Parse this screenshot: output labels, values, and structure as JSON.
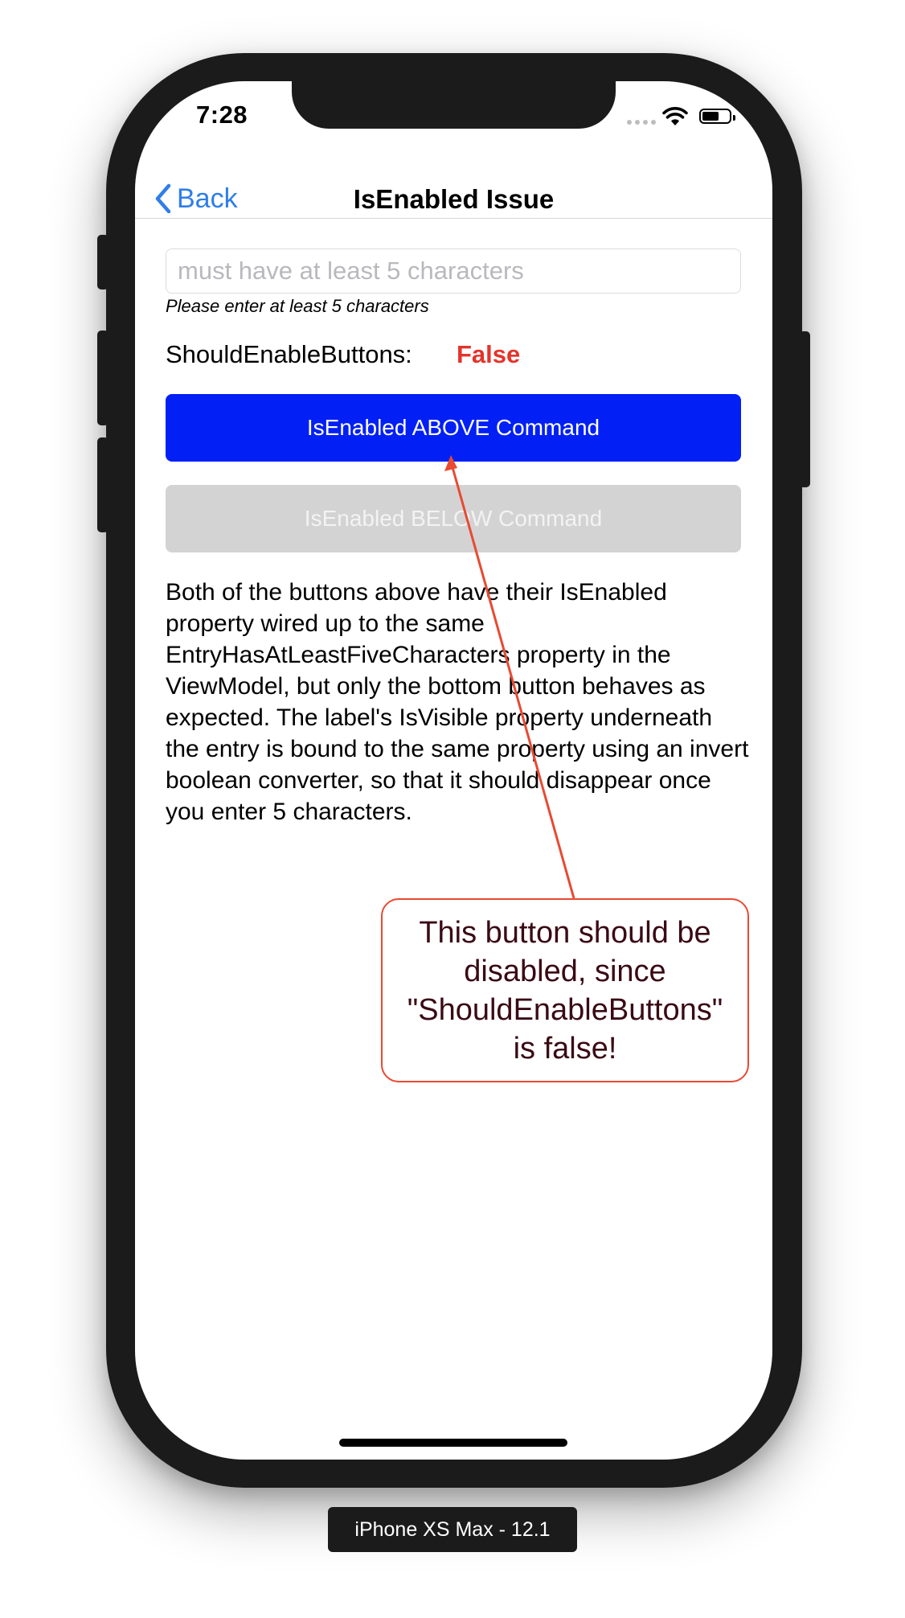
{
  "status_bar": {
    "time": "7:28",
    "signal_icon": "cellular-dots-icon",
    "wifi_icon": "wifi-icon",
    "battery_icon": "battery-icon"
  },
  "nav_bar": {
    "back_label": "Back",
    "back_icon": "chevron-left-icon",
    "title": "IsEnabled Issue",
    "accent_color": "#2f7ee8"
  },
  "form": {
    "entry_value": "",
    "entry_placeholder": "must have at least 5 characters",
    "hint_text": "Please enter at least 5 characters",
    "should_enable_label": "ShouldEnableButtons:",
    "should_enable_value": "False",
    "should_enable_color": "#e3342b"
  },
  "buttons": {
    "above_label": "IsEnabled ABOVE Command",
    "above_color": "#0220f5",
    "below_label": "IsEnabled BELOW Command",
    "below_color": "#d3d3d3"
  },
  "description": "Both of the buttons above have their IsEnabled property wired up to the same EntryHasAtLeastFiveCharacters property in the ViewModel, but only the bottom button behaves as expected. The label's IsVisible property underneath the entry is bound to the same property using an invert boolean converter, so that it should disappear once you enter 5 characters.",
  "annotation": {
    "text": "This button should be\ndisabled, since\n\"ShouldEnableButtons\"\nis false!",
    "color": "#e84a32"
  },
  "device_label": "iPhone XS Max - 12.1"
}
